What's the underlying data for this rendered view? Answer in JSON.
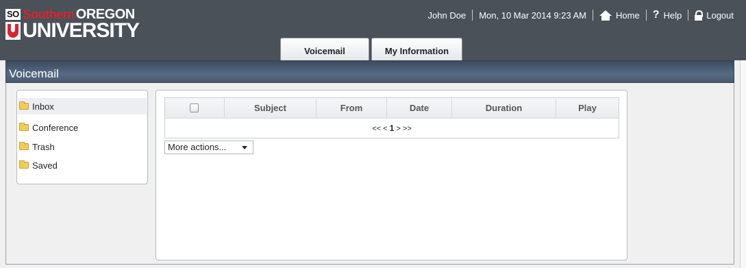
{
  "logo": {
    "so": "SO",
    "southern": "Southern",
    "oregon": "OREGON",
    "university": "UNIVERSITY"
  },
  "topbar": {
    "user": "John Doe",
    "datetime": "Mon, 10 Mar 2014 9:23 AM",
    "home": "Home",
    "help": "Help",
    "logout": "Logout",
    "home_icon": "home-icon",
    "help_icon": "question-mark-icon",
    "logout_icon": "lock-icon"
  },
  "tabs": [
    {
      "label": "Voicemail",
      "active": true
    },
    {
      "label": "My Information",
      "active": false
    }
  ],
  "section": {
    "title": "Voicemail"
  },
  "sidebar": {
    "folders": [
      {
        "label": "Inbox",
        "icon": "folder-icon",
        "active": true
      },
      {
        "label": "Conference",
        "icon": "folder-icon",
        "active": false
      },
      {
        "label": "Trash",
        "icon": "folder-icon",
        "active": false
      },
      {
        "label": "Saved",
        "icon": "folder-icon",
        "active": false
      }
    ]
  },
  "table": {
    "columns": [
      "Subject",
      "From",
      "Date",
      "Duration",
      "Play"
    ],
    "select_all_checked": false
  },
  "pager": {
    "first": "<<",
    "prev": "<",
    "page": "1",
    "next": ">",
    "last": ">>"
  },
  "actions": {
    "more_actions": "More actions..."
  },
  "colors": {
    "header_bg": "#4a5158",
    "brand_red": "#d8252e",
    "section_bar": "#4a5a70",
    "folder": "#f2cc5a"
  }
}
